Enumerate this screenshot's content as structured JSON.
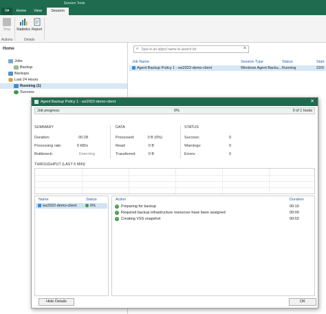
{
  "ribbon": {
    "context_label": "Session Tools",
    "tabs": [
      {
        "label": "Home"
      },
      {
        "label": "View"
      },
      {
        "label": "Session"
      }
    ],
    "buttons": [
      {
        "label": "Stop",
        "icon": "stop-icon"
      },
      {
        "label": "Statistics",
        "icon": "statistics-icon"
      },
      {
        "label": "Report",
        "icon": "report-icon"
      }
    ],
    "groups": [
      {
        "label": "Actions"
      },
      {
        "label": "Details"
      }
    ]
  },
  "nav": {
    "heading": "Home",
    "items": [
      {
        "label": "Jobs",
        "icon": "jobs-icon"
      },
      {
        "label": "Backup",
        "icon": "backup-icon"
      },
      {
        "label": "Backups",
        "icon": "backups-icon"
      },
      {
        "label": "Last 24 Hours",
        "icon": "history-icon"
      },
      {
        "label": "Running (1)",
        "icon": "running-icon"
      },
      {
        "label": "Success",
        "icon": "success-icon"
      }
    ]
  },
  "search": {
    "placeholder": "Type in an object name to search for"
  },
  "list": {
    "columns": [
      "Job Name",
      "Session Type",
      "Status",
      "Start"
    ],
    "rows": [
      {
        "job_name": "Agent Backup Policy 1 - ws2022-demo-client",
        "session_type": "Windows Agent Backu...",
        "status": "Running",
        "start": "22/0"
      }
    ]
  },
  "dialog": {
    "title": "Agent Backup Policy 1 - ws2022-demo-client",
    "close": "✕",
    "progress": {
      "label": "Job progress:",
      "percent_text": "0%",
      "percent": 0,
      "hosts": "0 of 1 hosts"
    },
    "summary": {
      "heading": "SUMMARY",
      "rows": [
        {
          "label": "Duration:",
          "value": "00:28"
        },
        {
          "label": "Processing rate:",
          "value": "0 KB/s"
        },
        {
          "label": "Bottleneck:",
          "value": "Detecting"
        }
      ]
    },
    "data": {
      "heading": "DATA",
      "rows": [
        {
          "label": "Processed:",
          "value": "0 B (0%)"
        },
        {
          "label": "Read:",
          "value": "0 B"
        },
        {
          "label": "Transferred:",
          "value": "0 B"
        }
      ]
    },
    "status": {
      "heading": "STATUS",
      "rows": [
        {
          "label": "Success:",
          "value": "0"
        },
        {
          "label": "Warnings:",
          "value": "0"
        },
        {
          "label": "Errors:",
          "value": "0"
        }
      ]
    },
    "throughput": {
      "heading": "THROUGHPUT (LAST 5 MIN)"
    },
    "vms": {
      "columns": [
        "Name",
        "Status"
      ],
      "rows": [
        {
          "name": "ws2022-demo-client",
          "status": "0%"
        }
      ]
    },
    "actions": {
      "columns": [
        "Action",
        "Duration"
      ],
      "rows": [
        {
          "text": "Preparing for backup",
          "duration": "00:10"
        },
        {
          "text": "Required backup infrastructure resources have been assigned",
          "duration": "00:00"
        },
        {
          "text": "Creating VSS snapshot",
          "duration": "00:02"
        }
      ]
    },
    "hide_details": "Hide Details",
    "ok": "OK"
  },
  "colors": {
    "brand": "#1e6b4f",
    "selection": "#d7e8f6",
    "success": "#3c9a4a",
    "progress": "#5fa36f"
  }
}
